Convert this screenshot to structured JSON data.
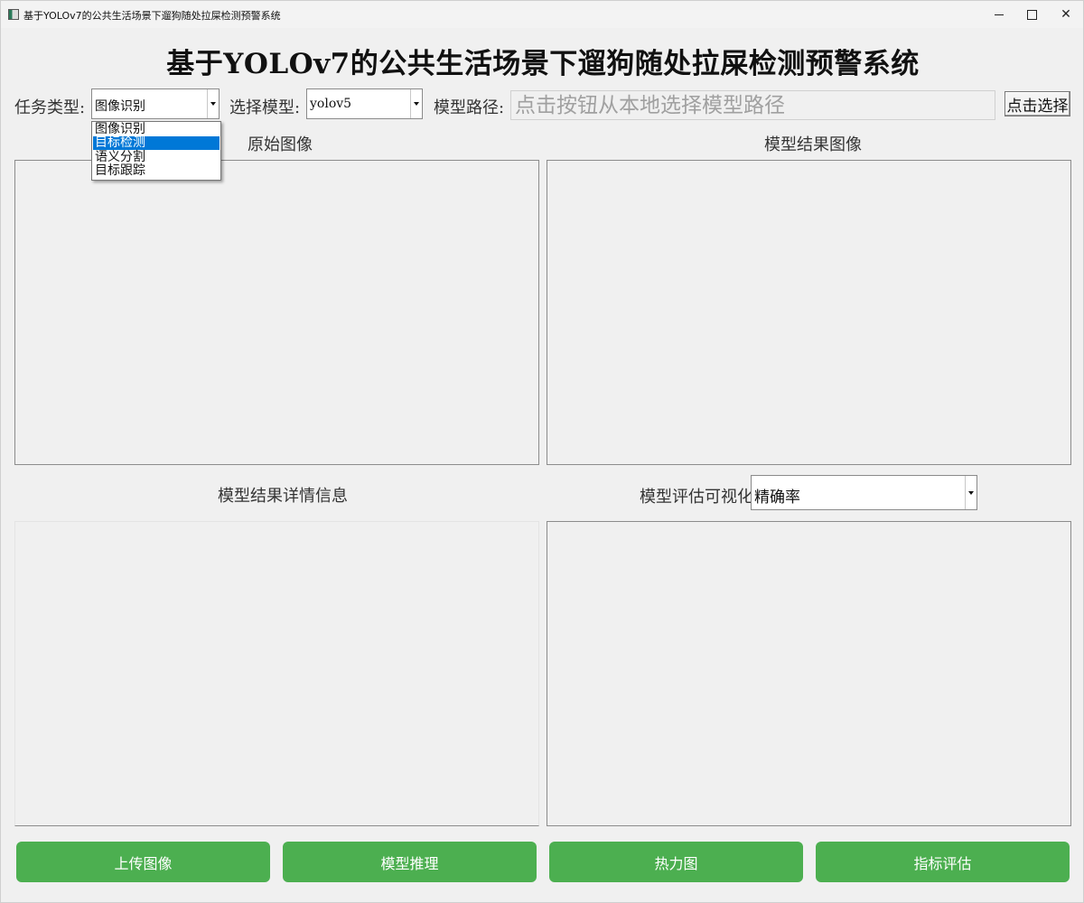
{
  "window": {
    "title": "基于YOLOv7的公共生活场景下遛狗随处拉屎检测预警系统",
    "controls": {
      "minimize": "—",
      "maximize": "☐",
      "close": "✕"
    }
  },
  "header": {
    "title": "基于YOLOv7的公共生活场景下遛狗随处拉屎检测预警系统"
  },
  "toolbar": {
    "task_type_label": "任务类型:",
    "task_type_value": "图像识别",
    "task_type_options": [
      "图像识别",
      "目标检测",
      "语义分割",
      "目标跟踪"
    ],
    "task_type_highlighted": "目标检测",
    "model_label": "选择模型:",
    "model_value": "yolov5",
    "model_path_label": "模型路径:",
    "model_path_placeholder": "点击按钮从本地选择模型路径",
    "select_button": "点击选择"
  },
  "panels": {
    "original_image_label": "原始图像",
    "result_image_label": "模型结果图像",
    "result_details_label": "模型结果详情信息",
    "evaluation_label": "模型评估可视化",
    "evaluation_metric_value": "精确率"
  },
  "actions": {
    "upload": "上传图像",
    "inference": "模型推理",
    "heatmap": "热力图",
    "metrics": "指标评估"
  },
  "colors": {
    "action_button": "#4caf50",
    "selection_highlight": "#0078d7",
    "background": "#f0f0f0"
  }
}
